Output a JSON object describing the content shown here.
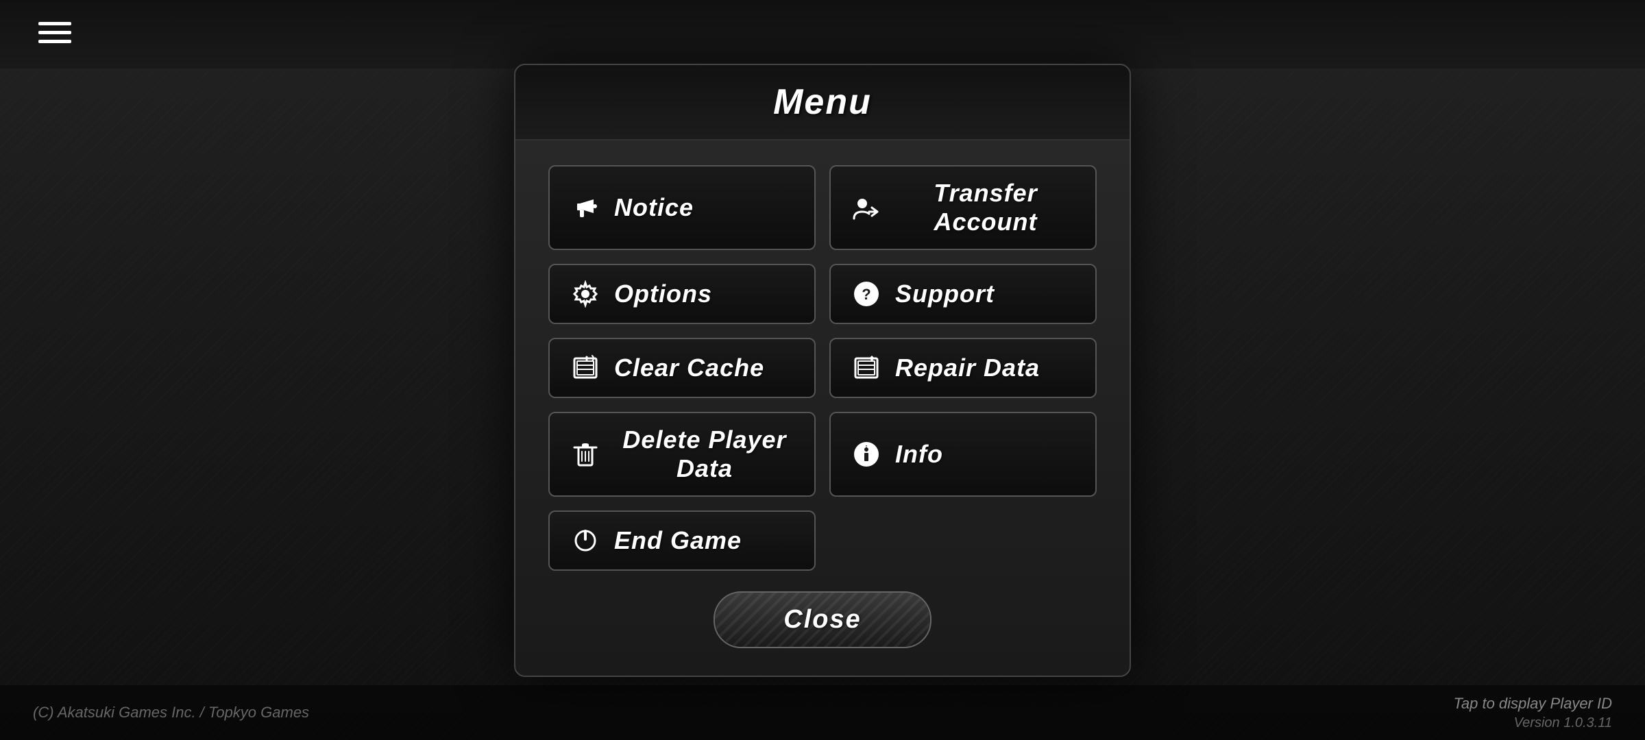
{
  "background": {
    "color": "#1a1a1a"
  },
  "header": {
    "hamburger_label": "menu"
  },
  "modal": {
    "title": "Menu",
    "buttons_left": [
      {
        "id": "notice",
        "label": "Notice",
        "icon": "megaphone"
      },
      {
        "id": "options",
        "label": "Options",
        "icon": "gear"
      },
      {
        "id": "clear-cache",
        "label": "Clear Cache",
        "icon": "clear-cache"
      },
      {
        "id": "delete-player-data",
        "label": "Delete Player Data",
        "icon": "trash"
      },
      {
        "id": "end-game",
        "label": "End Game",
        "icon": "power"
      }
    ],
    "buttons_right": [
      {
        "id": "transfer-account",
        "label": "Transfer Account",
        "icon": "transfer"
      },
      {
        "id": "support",
        "label": "Support",
        "icon": "question"
      },
      {
        "id": "repair-data",
        "label": "Repair Data",
        "icon": "repair"
      },
      {
        "id": "info",
        "label": "Info",
        "icon": "info"
      }
    ],
    "close_label": "Close"
  },
  "footer": {
    "copyright": "(C) Akatsuki Games Inc. / Topkyo Games",
    "tap_player_id": "Tap to display Player ID",
    "version": "Version 1.0.3.11"
  }
}
